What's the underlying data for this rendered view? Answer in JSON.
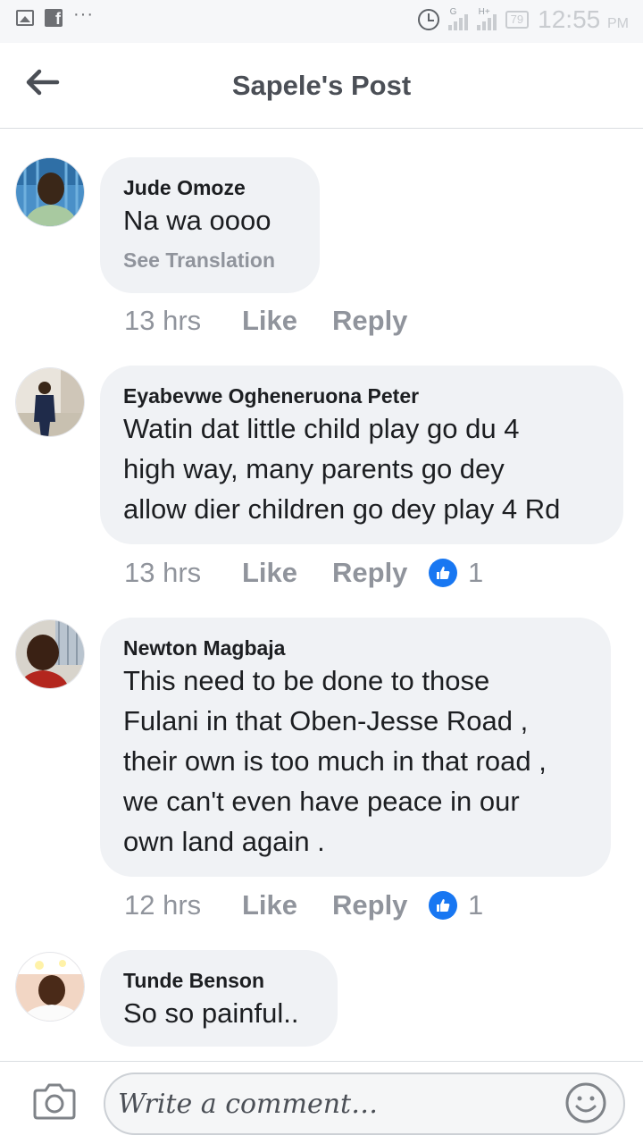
{
  "status_bar": {
    "network_label_1": "G",
    "network_label_2": "H+",
    "battery": "79",
    "time": "12:55",
    "ampm": "PM"
  },
  "header": {
    "title": "Sapele's Post"
  },
  "comments": [
    {
      "author": "Jude Omoze",
      "text": "Na wa oooo",
      "see_translation": "See Translation",
      "time": "13 hrs",
      "like_label": "Like",
      "reply_label": "Reply",
      "reactions": ""
    },
    {
      "author": "Eyabevwe Ogheneruona Peter",
      "text_lines": [
        "Watin dat little child play go du 4",
        "high way, many parents go dey",
        "allow dier children go dey play 4 Rd"
      ],
      "time": "13 hrs",
      "like_label": "Like",
      "reply_label": "Reply",
      "reactions": "1"
    },
    {
      "author": "Newton Magbaja",
      "text_lines": [
        "This need to be done to those",
        "Fulani in that Oben-Jesse Road ,",
        "their own is too much in that road ,",
        "we can't even have peace in our",
        "own land again ."
      ],
      "time": "12 hrs",
      "like_label": "Like",
      "reply_label": "Reply",
      "reactions": "1"
    },
    {
      "author": "Tunde Benson",
      "text": "So so painful.."
    }
  ],
  "composer": {
    "placeholder": "Write a comment…"
  },
  "icons": {
    "back": "back-arrow-icon",
    "camera": "camera-icon",
    "emoji": "emoji-icon",
    "like_reaction": "like-reaction-icon"
  },
  "colors": {
    "bubble": "#f0f2f5",
    "meta_text": "#90949c",
    "like_blue": "#1877f2"
  }
}
